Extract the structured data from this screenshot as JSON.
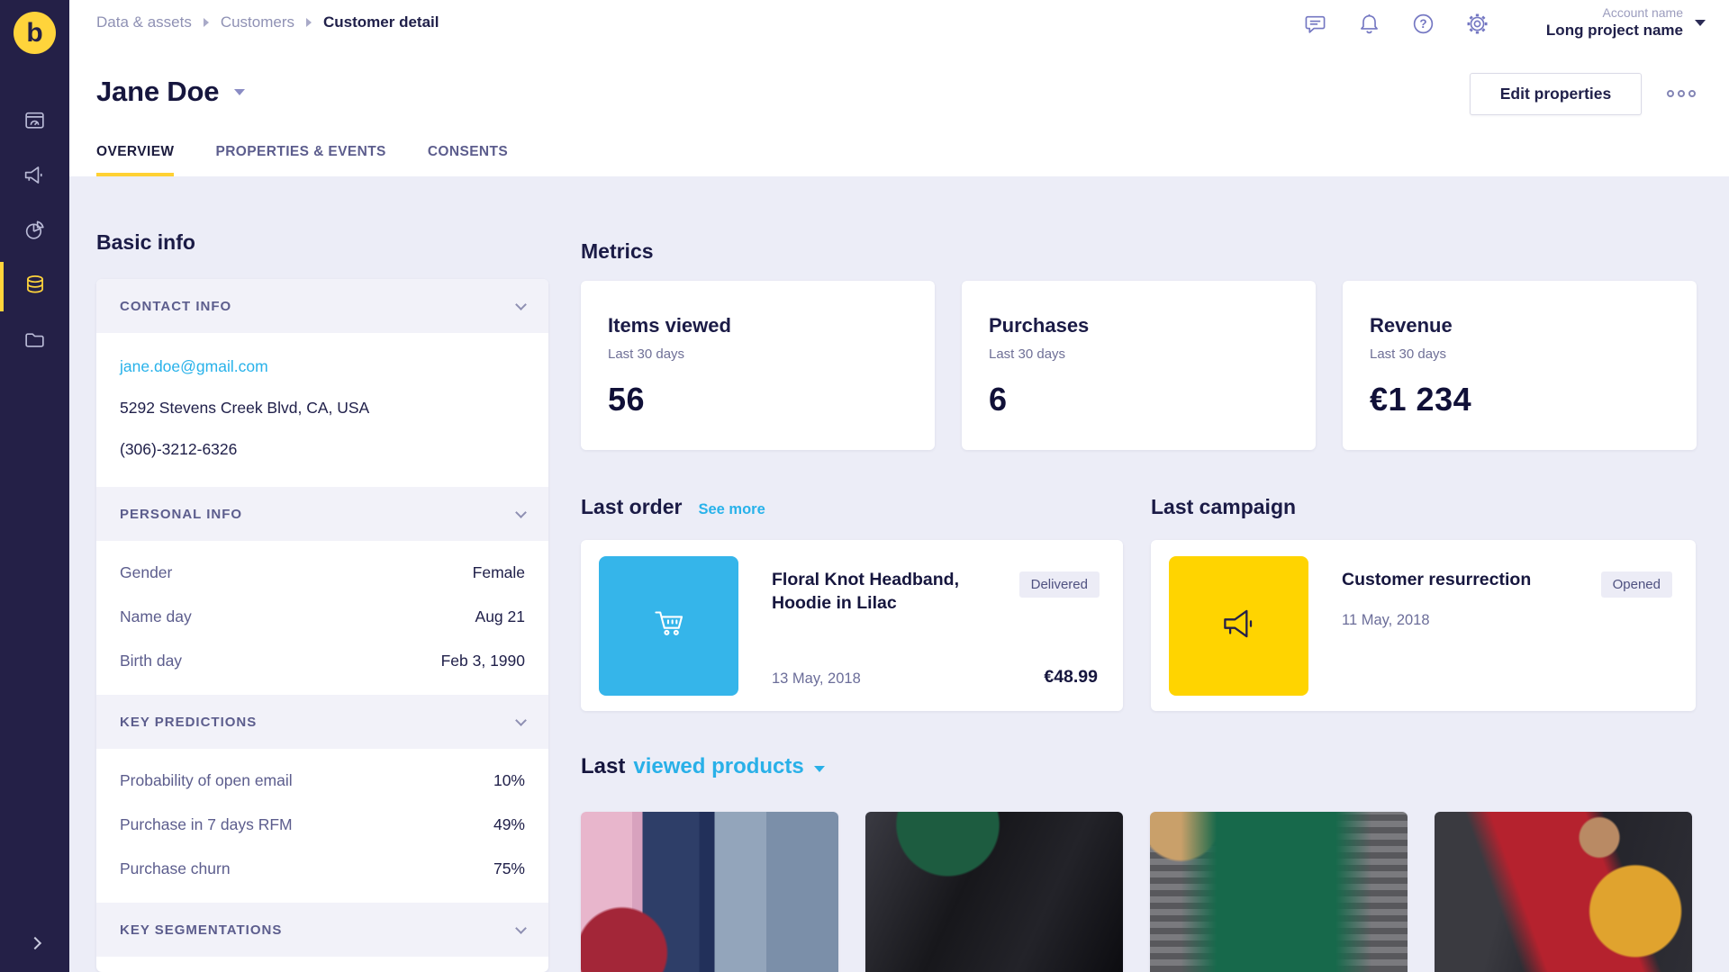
{
  "app": {
    "logo_letter": "b"
  },
  "colors": {
    "accent_yellow": "#FFD43B",
    "tab_underline_yellow": "#FFD133",
    "sidebar_navy": "#242047",
    "link_cyan": "#28B2EA",
    "order_tile_blue": "#35B5EA",
    "campaign_tile_yellow": "#FFD400",
    "badge_bg": "#ECECF6",
    "page_bg": "#ECEDF7"
  },
  "sidebar": {
    "items": [
      {
        "icon": "dashboard-icon"
      },
      {
        "icon": "megaphone-icon"
      },
      {
        "icon": "pie-chart-icon"
      },
      {
        "icon": "database-icon",
        "active": true
      },
      {
        "icon": "folder-icon"
      }
    ],
    "expand_icon": "chevron-right-icon"
  },
  "breadcrumb": {
    "items": [
      "Data & assets",
      "Customers",
      "Customer detail"
    ]
  },
  "header": {
    "icons": [
      "chat-icon",
      "bell-icon",
      "help-icon",
      "gear-icon"
    ],
    "account_label": "Account name",
    "project_name": "Long project name"
  },
  "page": {
    "title": "Jane Doe"
  },
  "actions": {
    "edit_properties": "Edit properties"
  },
  "tabs": [
    {
      "label": "OVERVIEW",
      "active": true
    },
    {
      "label": "PROPERTIES & EVENTS",
      "active": false
    },
    {
      "label": "CONSENTS",
      "active": false
    }
  ],
  "basic_info": {
    "title": "Basic info",
    "contact": {
      "header": "CONTACT INFO",
      "email": "jane.doe@gmail.com",
      "address": "5292 Stevens Creek Blvd, CA, USA",
      "phone": "(306)-3212-6326"
    },
    "personal": {
      "header": "PERSONAL INFO",
      "rows": [
        {
          "label": "Gender",
          "value": "Female"
        },
        {
          "label": "Name day",
          "value": "Aug 21"
        },
        {
          "label": "Birth day",
          "value": "Feb 3, 1990"
        }
      ]
    },
    "predictions": {
      "header": "KEY PREDICTIONS",
      "rows": [
        {
          "label": "Probability of open email",
          "value": "10%"
        },
        {
          "label": "Purchase in 7 days RFM",
          "value": "49%"
        },
        {
          "label": "Purchase churn",
          "value": "75%"
        }
      ]
    },
    "segmentations": {
      "header": "KEY SEGMENTATIONS"
    }
  },
  "metrics": {
    "title": "Metrics",
    "cards": [
      {
        "title": "Items viewed",
        "period": "Last 30 days",
        "value": "56"
      },
      {
        "title": "Purchases",
        "period": "Last 30 days",
        "value": "6"
      },
      {
        "title": "Revenue",
        "period": "Last 30 days",
        "value": "€1 234"
      }
    ]
  },
  "last_order": {
    "title": "Last order",
    "see_more": "See more",
    "product_name": "Floral Knot Headband, Hoodie in Lilac",
    "status": "Delivered",
    "date": "13 May, 2018",
    "price": "€48.99",
    "icon": "cart-icon"
  },
  "last_campaign": {
    "title": "Last campaign",
    "name": "Customer resurrection",
    "status": "Opened",
    "date": "11 May, 2018",
    "icon": "megaphone-icon"
  },
  "last_viewed": {
    "prefix": "Last",
    "selector": "viewed products",
    "products": [
      "pink-coat-denim-red-round-bag",
      "black-leather-bag-fishnets-green-fur",
      "green-shaggy-fur-coat",
      "red-striped-bag-yellow-top"
    ]
  }
}
